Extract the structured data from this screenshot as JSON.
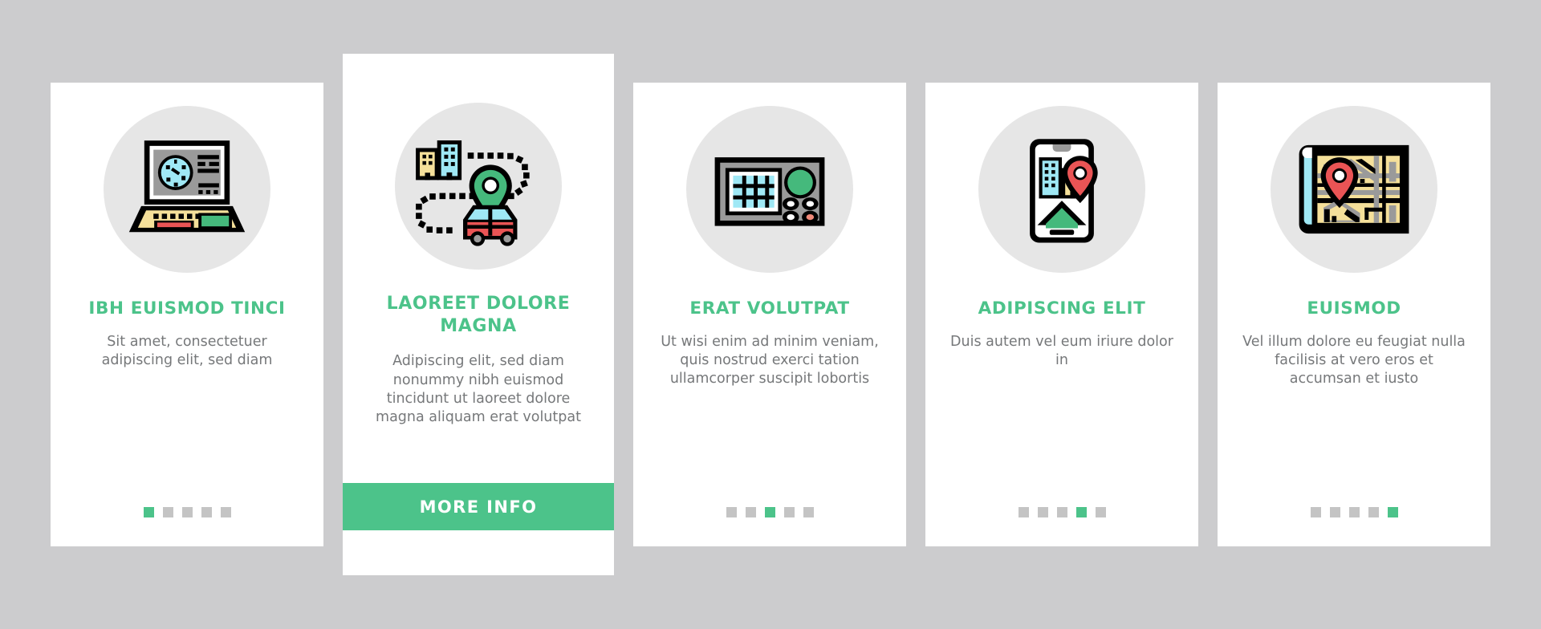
{
  "theme": {
    "background": "#ccccce",
    "card_background": "#ffffff",
    "accent": "#4cc38a",
    "title_color": "#4cc38a",
    "body_text_color": "#76787a",
    "dot_inactive": "#c4c4c4",
    "icon_circle": "#e6e6e6"
  },
  "cards": [
    {
      "icon": "laptop-radar-icon",
      "title": "IBH EUISMOD TINCI",
      "description": "Sit amet, consectetuer adipiscing elit, sed diam",
      "dots": {
        "count": 5,
        "active": 1
      },
      "featured": false
    },
    {
      "icon": "car-route-city-pin-icon",
      "title": "LAOREET DOLORE MAGNA",
      "description": "Adipiscing elit, sed diam nonummy nibh euismod tincidunt ut laoreet dolore magna aliquam erat volutpat",
      "button_label": "MORE INFO",
      "featured": true
    },
    {
      "icon": "gps-navigator-device-icon",
      "title": "ERAT VOLUTPAT",
      "description": "Ut wisi enim ad minim veniam, quis nostrud exerci tation ullamcorper suscipit lobortis",
      "dots": {
        "count": 5,
        "active": 3
      },
      "featured": false
    },
    {
      "icon": "smartphone-navigation-icon",
      "title": "ADIPISCING ELIT",
      "description": "Duis autem vel eum iriure dolor in",
      "dots": {
        "count": 5,
        "active": 4
      },
      "featured": false
    },
    {
      "icon": "paper-map-pin-icon",
      "title": "EUISMOD",
      "description": "Vel illum dolore eu feugiat nulla facilisis at vero eros et accumsan et iusto",
      "dots": {
        "count": 5,
        "active": 5
      },
      "featured": false
    }
  ]
}
